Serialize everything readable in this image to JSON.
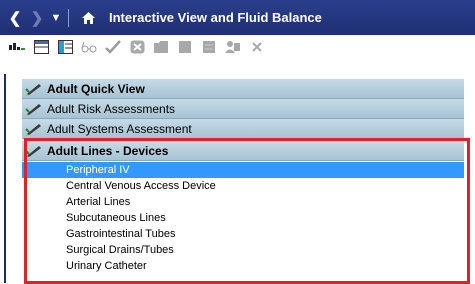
{
  "window": {
    "title": "Interactive View and Fluid Balance"
  },
  "titlebar": {
    "back_icon": "back-arrow-icon",
    "forward_icon": "forward-arrow-icon",
    "dropdown_icon": "dropdown-icon",
    "home_icon": "home-icon"
  },
  "toolbar": {
    "icons": [
      "bar-chart-icon",
      "grid-icon",
      "table-icon",
      "glasses-icon",
      "checkmark-icon",
      "cancel-icon",
      "folder-icon",
      "document-icon",
      "list-icon",
      "person-icon",
      "close-icon"
    ]
  },
  "sections": [
    {
      "label": "Adult Quick View"
    },
    {
      "label": "Adult Risk Assessments"
    },
    {
      "label": "Adult Systems Assessment"
    },
    {
      "label": "Adult Lines - Devices",
      "items": [
        {
          "label": "Peripheral IV",
          "selected": true
        },
        {
          "label": "Central Venous Access Device",
          "selected": false
        },
        {
          "label": "Arterial Lines",
          "selected": false
        },
        {
          "label": "Subcutaneous Lines",
          "selected": false
        },
        {
          "label": "Gastrointestinal Tubes",
          "selected": false
        },
        {
          "label": "Surgical Drains/Tubes",
          "selected": false
        },
        {
          "label": "Urinary Catheter",
          "selected": false
        }
      ]
    }
  ],
  "colors": {
    "titlebar": "#1f2f73",
    "section_header": "#b4cddb",
    "selection": "#3399ff",
    "highlight_box": "#e0202a"
  }
}
